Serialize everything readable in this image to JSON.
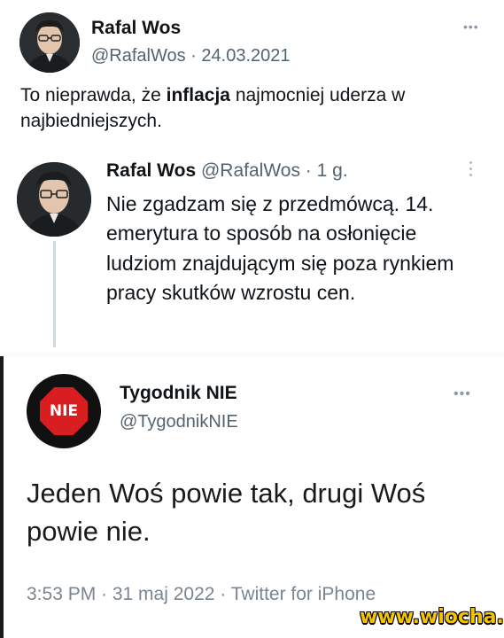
{
  "tweet1": {
    "author_name": "Rafal Wos",
    "handle": "@RafalWos",
    "date": "· 24.03.2021",
    "text_part1": "To nieprawda, że ",
    "text_bold": "inflacja",
    "text_part2": " najmocniej uderza w najbiedniejszych."
  },
  "tweet2": {
    "author_name": "Rafal Wos",
    "handle": "@RafalWos",
    "time": "· 1 g.",
    "text": "Nie zgadzam się z przedmówcą. 14. emerytura to sposób na osłonięcie ludziom znajdującym się poza rynkiem pracy skutków wzrostu cen."
  },
  "tweet3": {
    "author_name": "Tygodnik NIE",
    "handle": "@TygodnikNIE",
    "avatar_text": "NIE",
    "text": "Jeden Woś powie tak, drugi Woś powie nie.",
    "meta": "3:53 PM · 31 maj 2022 · Twitter for iPhone"
  },
  "watermark": "www.wiocha.pl",
  "colors": {
    "muted": "#536471",
    "nie_red": "#d81e20",
    "watermark": "#f5c400"
  }
}
